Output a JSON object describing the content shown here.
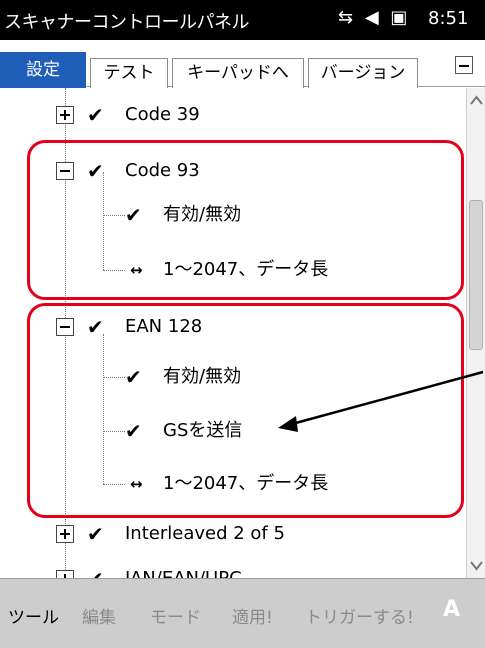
{
  "titlebar": {
    "title": "スキャナーコントロールパネル",
    "status_icons": [
      "connectivity-icon",
      "volume-icon",
      "battery-icon"
    ],
    "status_glyphs": [
      "⇆",
      "◀",
      "▣"
    ],
    "time": "8:51"
  },
  "tabs": [
    {
      "label": "設定",
      "active": true
    },
    {
      "label": "テスト",
      "active": false
    },
    {
      "label": "キーパッドへ",
      "active": false
    },
    {
      "label": "バージョン",
      "active": false
    }
  ],
  "tree": {
    "items": [
      {
        "label": "Code 39",
        "type": "node",
        "expanded": false,
        "checked": true
      },
      {
        "label": "Code 93",
        "type": "node",
        "expanded": true,
        "checked": true
      },
      {
        "label": "有効/無効",
        "type": "check",
        "checked": true
      },
      {
        "label": "1～2047、データ長",
        "type": "range"
      },
      {
        "label": "EAN 128",
        "type": "node",
        "expanded": true,
        "checked": true
      },
      {
        "label": "有効/無効",
        "type": "check",
        "checked": true
      },
      {
        "label": "GSを送信",
        "type": "check",
        "checked": true
      },
      {
        "label": "1～2047、データ長",
        "type": "range"
      },
      {
        "label": "Interleaved 2 of 5",
        "type": "node",
        "expanded": false,
        "checked": true
      },
      {
        "label": "JAN/EAN/UPC",
        "type": "node",
        "expanded": false,
        "checked": true
      }
    ],
    "check_glyph": "✔",
    "range_glyph": "↔"
  },
  "menu": {
    "items": [
      {
        "label": "ツール",
        "enabled": true
      },
      {
        "label": "編集",
        "enabled": false
      },
      {
        "label": "モード",
        "enabled": false
      },
      {
        "label": "適用!",
        "enabled": false
      },
      {
        "label": "トリガーする!",
        "enabled": false
      }
    ],
    "input_mode": "A"
  },
  "colors": {
    "highlight": "#e5001a",
    "active_tab": "#1f5fb9"
  }
}
